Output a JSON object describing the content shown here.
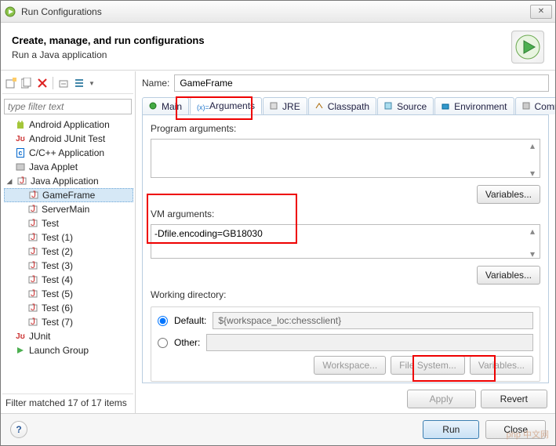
{
  "window": {
    "title": "Run Configurations"
  },
  "header": {
    "title": "Create, manage, and run configurations",
    "subtitle": "Run a Java application"
  },
  "filter": {
    "placeholder": "type filter text",
    "status": "Filter matched 17 of 17 items"
  },
  "tree": {
    "items": [
      {
        "label": "Android Application",
        "icon": "android",
        "expandable": false
      },
      {
        "label": "Android JUnit Test",
        "icon": "junit",
        "expandable": false
      },
      {
        "label": "C/C++ Application",
        "icon": "cpp",
        "expandable": false
      },
      {
        "label": "Java Applet",
        "icon": "applet",
        "expandable": false
      },
      {
        "label": "Java Application",
        "icon": "java",
        "expandable": true,
        "expanded": true
      },
      {
        "label": "JUnit",
        "icon": "junit",
        "expandable": false
      },
      {
        "label": "Launch Group",
        "icon": "launch",
        "expandable": false
      }
    ],
    "javaChildren": [
      "GameFrame",
      "ServerMain",
      "Test",
      "Test (1)",
      "Test (2)",
      "Test (3)",
      "Test (4)",
      "Test (5)",
      "Test (6)",
      "Test (7)"
    ],
    "selected": "GameFrame"
  },
  "form": {
    "nameLabel": "Name:",
    "nameValue": "GameFrame",
    "tabs": [
      "Main",
      "Arguments",
      "JRE",
      "Classpath",
      "Source",
      "Environment",
      "Common"
    ],
    "activeTab": "Arguments",
    "programArgsLabel": "Program arguments:",
    "programArgsValue": "",
    "vmArgsLabel": "VM arguments:",
    "vmArgsValue": "-Dfile.encoding=GB18030",
    "variablesBtn": "Variables...",
    "workingDirLabel": "Working directory:",
    "defaultLabel": "Default:",
    "defaultValue": "${workspace_loc:chessclient}",
    "otherLabel": "Other:",
    "workspaceBtn": "Workspace...",
    "fileSystemBtn": "File System...",
    "applyBtn": "Apply",
    "revertBtn": "Revert"
  },
  "footer": {
    "runBtn": "Run",
    "closeBtn": "Close"
  }
}
